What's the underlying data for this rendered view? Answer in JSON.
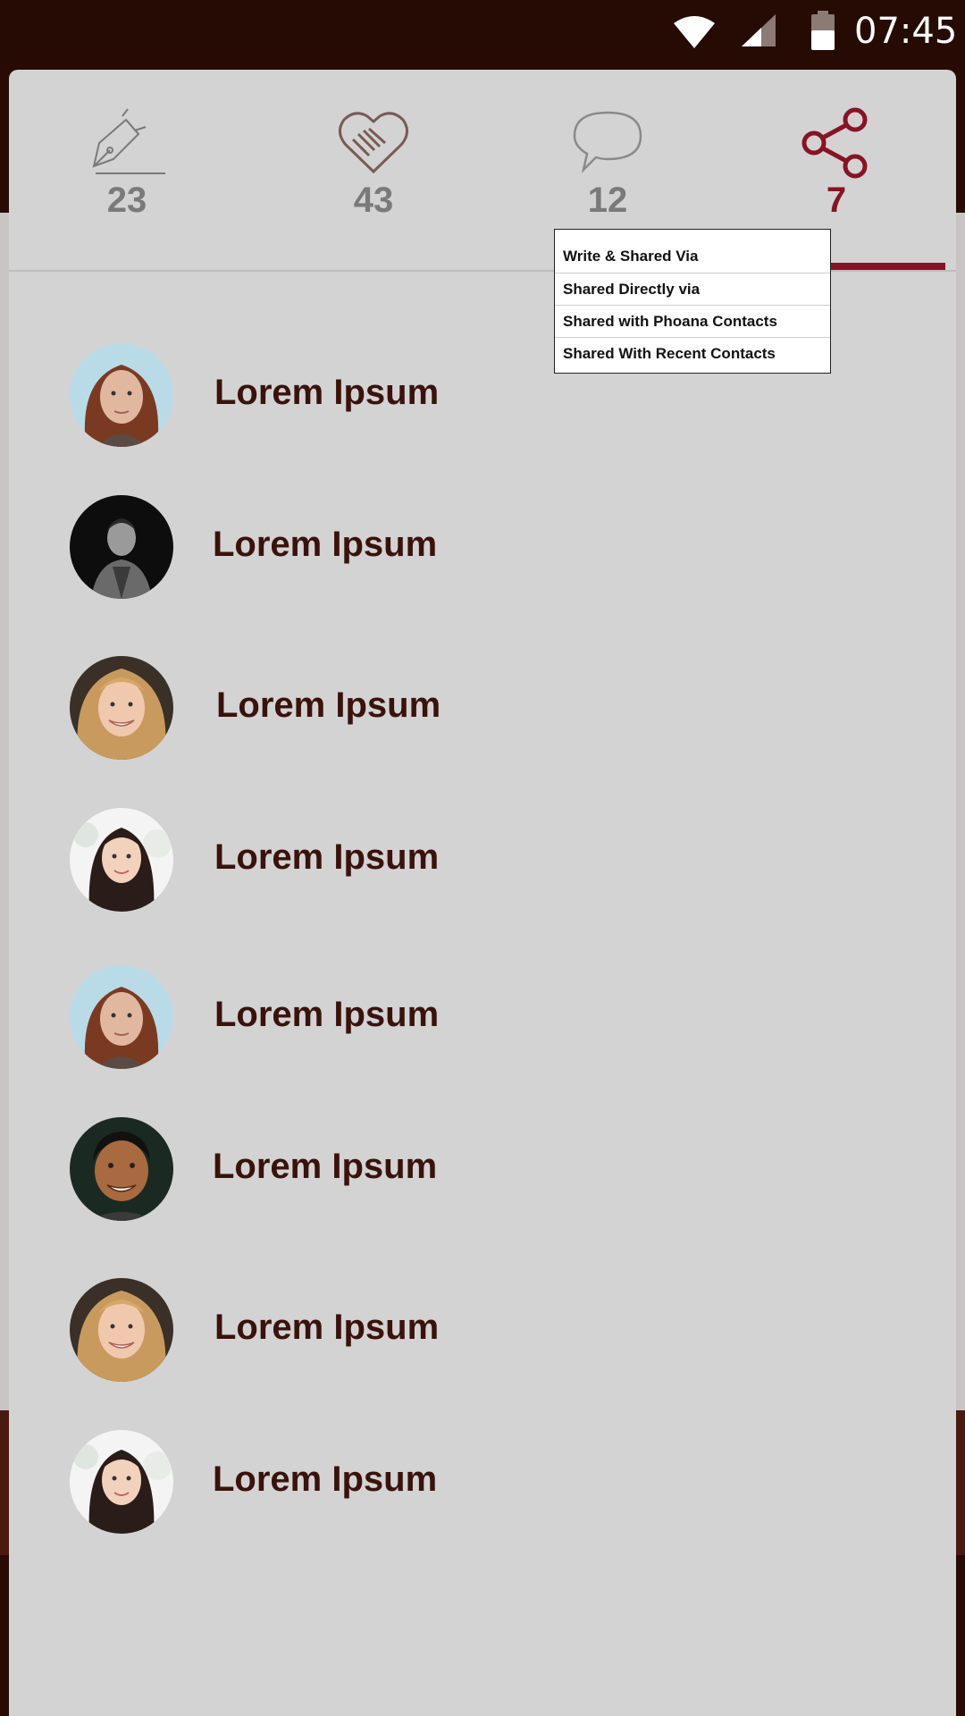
{
  "status_bar": {
    "time": "07:45"
  },
  "tabs": [
    {
      "icon": "pen-nib-icon",
      "count": "23",
      "active": false
    },
    {
      "icon": "heart-handshake-icon",
      "count": "43",
      "active": false
    },
    {
      "icon": "speech-bubble-icon",
      "count": "12",
      "active": false
    },
    {
      "icon": "share-icon",
      "count": "7",
      "active": true
    }
  ],
  "colors": {
    "accent": "#8a1224",
    "sheet": "#d3d3d3",
    "status_bar": "#260b04",
    "name_text": "#3a120c"
  },
  "share_menu": {
    "items": [
      "Write & Shared Via",
      "Shared Directly via",
      "Shared with Phoana Contacts",
      "Shared With Recent Contacts"
    ]
  },
  "contacts": [
    {
      "name": "Lorem Ipsum",
      "avatar": "avatar-redhair-woman"
    },
    {
      "name": "Lorem Ipsum",
      "avatar": "avatar-bw-man"
    },
    {
      "name": "Lorem Ipsum",
      "avatar": "avatar-blonde-woman"
    },
    {
      "name": "Lorem Ipsum",
      "avatar": "avatar-asian-woman"
    },
    {
      "name": "Lorem Ipsum",
      "avatar": "avatar-redhair-woman"
    },
    {
      "name": "Lorem Ipsum",
      "avatar": "avatar-smiling-man"
    },
    {
      "name": "Lorem Ipsum",
      "avatar": "avatar-blonde-woman"
    },
    {
      "name": "Lorem Ipsum",
      "avatar": "avatar-asian-woman"
    }
  ]
}
